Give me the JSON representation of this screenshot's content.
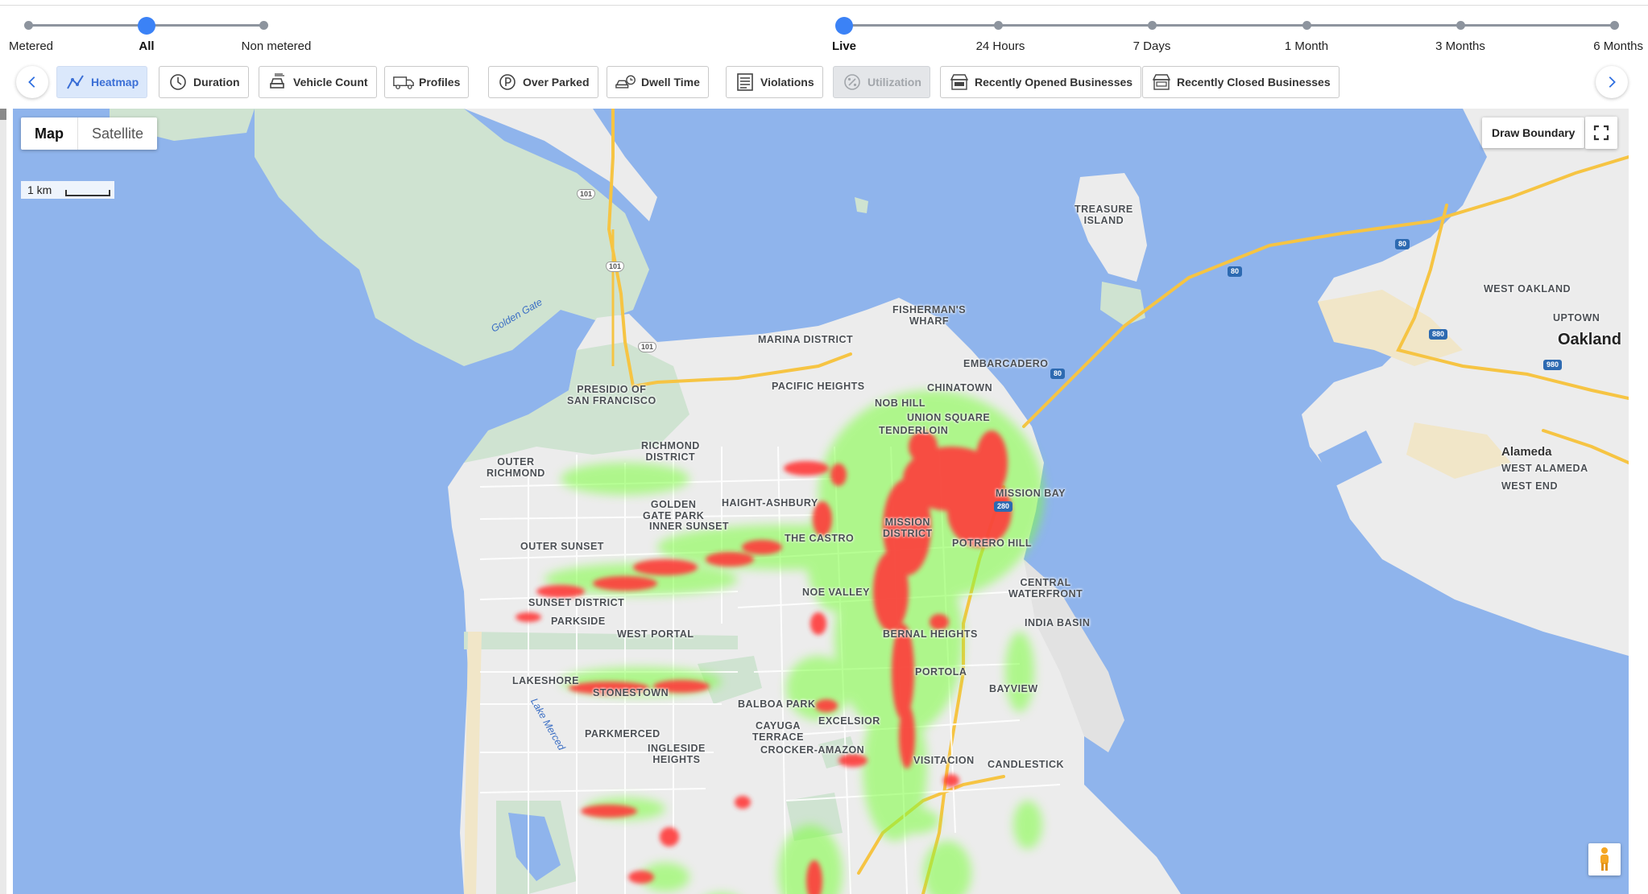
{
  "meter_slider": {
    "stops": [
      {
        "label": "Metered",
        "active": false
      },
      {
        "label": "All",
        "active": true
      },
      {
        "label": "Non metered",
        "active": false
      }
    ]
  },
  "time_slider": {
    "stops": [
      {
        "label": "Live",
        "active": true
      },
      {
        "label": "24 Hours",
        "active": false
      },
      {
        "label": "7 Days",
        "active": false
      },
      {
        "label": "1 Month",
        "active": false
      },
      {
        "label": "3 Months",
        "active": false
      },
      {
        "label": "6 Months",
        "active": false
      }
    ]
  },
  "toolbar": {
    "prev_icon": "chevron-left-icon",
    "next_icon": "chevron-right-icon",
    "chips": [
      {
        "label": "Heatmap",
        "icon": "heatmap-line-icon",
        "state": "selected"
      },
      {
        "label": "Duration",
        "icon": "clock-icon",
        "state": "normal"
      },
      {
        "label": "Vehicle Count",
        "icon": "car-count-icon",
        "state": "normal"
      },
      {
        "label": "Profiles",
        "icon": "truck-icon",
        "state": "normal"
      },
      {
        "label": "Over Parked",
        "icon": "parking-clock-icon",
        "state": "normal"
      },
      {
        "label": "Dwell Time",
        "icon": "car-clock-icon",
        "state": "normal"
      },
      {
        "label": "Violations",
        "icon": "violation-list-icon",
        "state": "normal"
      },
      {
        "label": "Utilization",
        "icon": "percent-icon",
        "state": "disabled"
      },
      {
        "label": "Recently Opened Businesses",
        "icon": "open-store-icon",
        "state": "normal"
      },
      {
        "label": "Recently Closed Businesses",
        "icon": "closed-store-icon",
        "state": "normal"
      }
    ]
  },
  "map": {
    "type_toggle": {
      "map": "Map",
      "satellite": "Satellite",
      "selected": "Map"
    },
    "scale": "1 km",
    "draw_boundary": "Draw Boundary",
    "colors": {
      "water": "#8fb4ec",
      "land": "#ececec",
      "park": "#cfe3d1",
      "sand": "#f1e6c8",
      "highway": "#f6c443",
      "heat_high": "#ff3b3b",
      "heat_low": "#7dff3c"
    },
    "labels": {
      "treasure_island": "TREASURE\nISLAND",
      "golden_gate": "Golden Gate",
      "marina": "MARINA DISTRICT",
      "fishermans_wharf": "FISHERMAN'S\nWHARF",
      "embarcadero": "EMBARCADERO",
      "chinatown": "CHINATOWN",
      "presidio": "PRESIDIO OF\nSAN FRANCISCO",
      "pacific_heights": "PACIFIC HEIGHTS",
      "nob_hill": "NOB HILL",
      "union_square": "UNION SQUARE",
      "tenderloin": "TENDERLOIN",
      "richmond": "RICHMOND\nDISTRICT",
      "outer_richmond": "OUTER\nRICHMOND",
      "haight": "HAIGHT-ASHBURY",
      "golden_gate_park": "GOLDEN\nGATE PARK",
      "mission_bay": "MISSION BAY",
      "inner_sunset": "INNER SUNSET",
      "outer_sunset": "OUTER SUNSET",
      "castro": "THE CASTRO",
      "mission": "MISSION\nDISTRICT",
      "potrero": "POTRERO HILL",
      "noe": "NOE VALLEY",
      "central_waterfront": "CENTRAL\nWATERFRONT",
      "sunset": "SUNSET DISTRICT",
      "parkside": "PARKSIDE",
      "west_portal": "WEST PORTAL",
      "india_basin": "INDIA BASIN",
      "bernal": "BERNAL HEIGHTS",
      "lakeshore": "LAKESHORE",
      "portola": "PORTOLA",
      "stonestown": "STONESTOWN",
      "bayview": "BAYVIEW",
      "balboa": "BALBOA PARK",
      "excelsior": "EXCELSIOR",
      "parkmerced": "PARKMERCED",
      "cayuga": "CAYUGA\nTERRACE",
      "ingleside": "INGLESIDE\nHEIGHTS",
      "crocker": "CROCKER-AMAZON",
      "visitacion": "VISITACION",
      "candlestick": "CANDLESTICK",
      "lake_merced": "Lake Merced",
      "west_oakland": "WEST OAKLAND",
      "uptown": "UPTOWN",
      "oakland": "Oakland",
      "alameda": "Alameda",
      "west_alameda": "WEST ALAMEDA",
      "west_end": "WEST END"
    }
  }
}
